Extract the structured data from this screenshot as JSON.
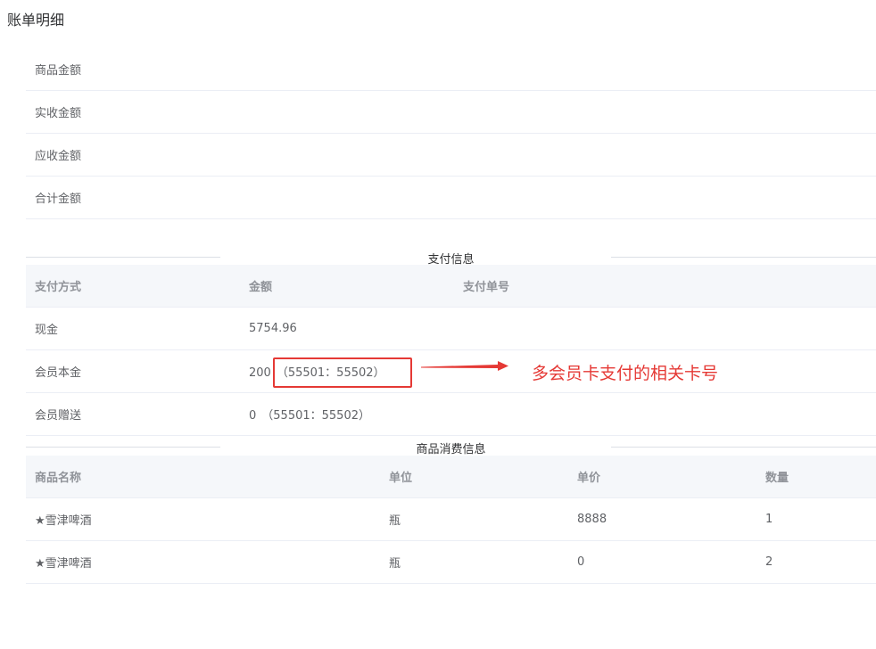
{
  "page": {
    "title": "账单明细"
  },
  "amounts": [
    {
      "label": "商品金额"
    },
    {
      "label": "实收金额"
    },
    {
      "label": "应收金额"
    },
    {
      "label": "合计金额"
    }
  ],
  "payment": {
    "section_title": "支付信息",
    "columns": [
      "支付方式",
      "金额",
      "支付单号"
    ],
    "rows": [
      {
        "method": "现金",
        "amount": "5754.96",
        "cards": "",
        "order_no": ""
      },
      {
        "method": "会员本金",
        "amount": "200",
        "cards": "（55501：55502）",
        "order_no": ""
      },
      {
        "method": "会员赠送",
        "amount": "0",
        "cards": "（55501：55502）",
        "order_no": ""
      }
    ]
  },
  "goods": {
    "section_title": "商品消费信息",
    "columns": [
      "商品名称",
      "单位",
      "单价",
      "数量"
    ],
    "rows": [
      {
        "name": "★雪津啤酒",
        "unit": "瓶",
        "price": "8888",
        "qty": "1"
      },
      {
        "name": "★雪津啤酒",
        "unit": "瓶",
        "price": "0",
        "qty": "2"
      }
    ]
  },
  "annotation": {
    "text": "多会员卡支付的相关卡号",
    "color": "#e53935"
  }
}
